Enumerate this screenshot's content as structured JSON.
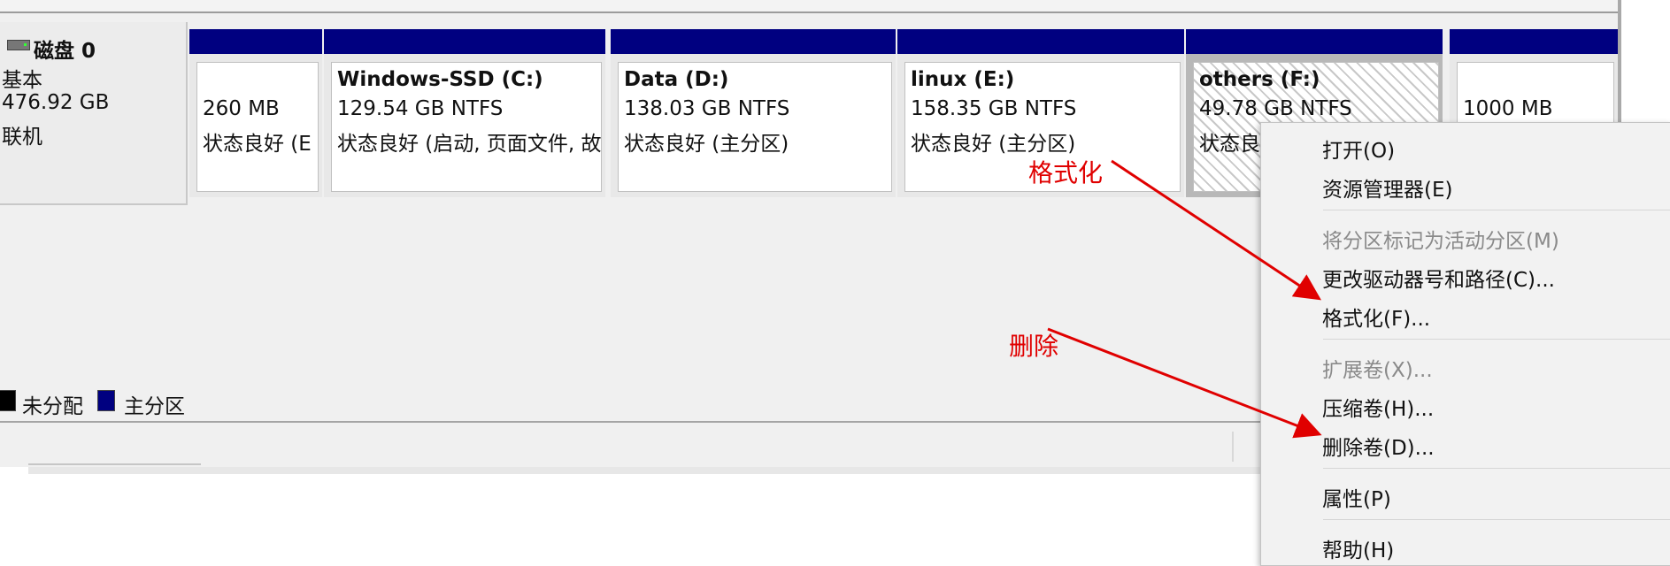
{
  "disk": {
    "name": "磁盘 0",
    "type": "基本",
    "size": "476.92 GB",
    "status": "联机"
  },
  "partitions": [
    {
      "label": "",
      "size": "260 MB",
      "status": "状态良好 (E"
    },
    {
      "label": "Windows-SSD  (C:)",
      "size": "129.54 GB NTFS",
      "status": "状态良好 (启动, 页面文件, 故"
    },
    {
      "label": "Data  (D:)",
      "size": "138.03 GB NTFS",
      "status": "状态良好 (主分区)"
    },
    {
      "label": "linux  (E:)",
      "size": "158.35 GB NTFS",
      "status": "状态良好 (主分区)"
    },
    {
      "label": "others  (F:)",
      "size": "49.78 GB NTFS",
      "status": "状态良"
    },
    {
      "label": "",
      "size": "1000 MB",
      "status": ""
    }
  ],
  "legend": {
    "unallocated": "未分配",
    "primary": "主分区",
    "colors": {
      "unallocated": "#000000",
      "primary": "#000080"
    }
  },
  "context_menu": {
    "items": [
      {
        "label": "打开(O)",
        "disabled": false
      },
      {
        "label": "资源管理器(E)",
        "disabled": false
      },
      {
        "label": "将分区标记为活动分区(M)",
        "disabled": true
      },
      {
        "label": "更改驱动器号和路径(C)...",
        "disabled": false
      },
      {
        "label": "格式化(F)...",
        "disabled": false
      },
      {
        "label": "扩展卷(X)...",
        "disabled": true
      },
      {
        "label": "压缩卷(H)...",
        "disabled": false
      },
      {
        "label": "删除卷(D)...",
        "disabled": false
      },
      {
        "label": "属性(P)",
        "disabled": false
      },
      {
        "label": "帮助(H)",
        "disabled": false
      }
    ]
  },
  "annotations": {
    "format_label": "格式化",
    "delete_label": "删除",
    "color": "#e00000"
  }
}
